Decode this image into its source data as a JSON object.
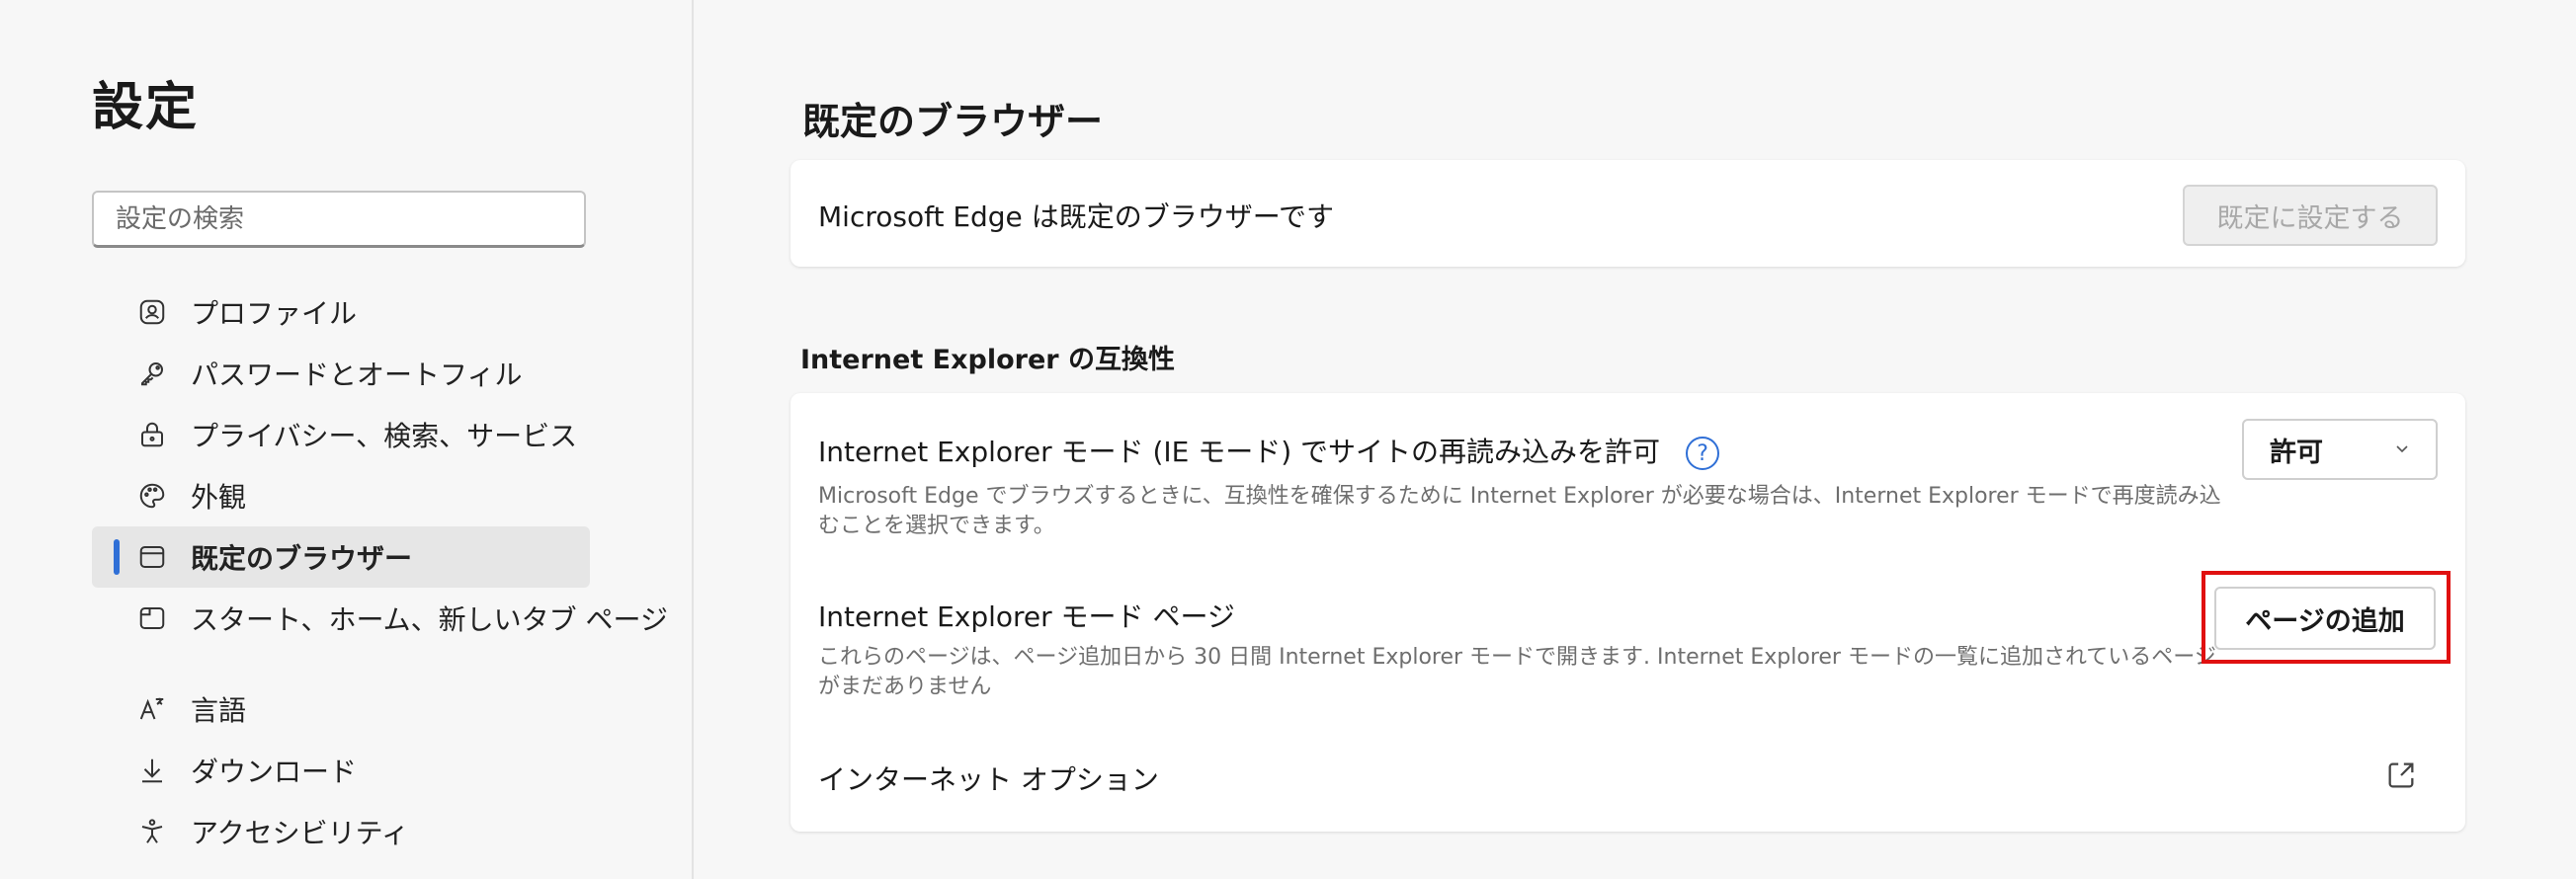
{
  "sidebar": {
    "title": "設定",
    "search_placeholder": "設定の検索",
    "items": [
      {
        "label": "プロファイル",
        "icon": "profile-icon"
      },
      {
        "label": "パスワードとオートフィル",
        "icon": "key-icon"
      },
      {
        "label": "プライバシー、検索、サービス",
        "icon": "lock-icon"
      },
      {
        "label": "外観",
        "icon": "palette-icon"
      },
      {
        "label": "既定のブラウザー",
        "icon": "browser-icon",
        "active": true
      },
      {
        "label": "スタート、ホーム、新しいタブ ページ",
        "icon": "home-tab-icon"
      },
      {
        "label": "言語",
        "icon": "language-icon"
      },
      {
        "label": "ダウンロード",
        "icon": "download-icon"
      },
      {
        "label": "アクセシビリティ",
        "icon": "accessibility-icon"
      }
    ]
  },
  "main": {
    "title": "既定のブラウザー",
    "default_card": {
      "text": "Microsoft Edge は既定のブラウザーです",
      "button_label": "既定に設定する"
    },
    "ie_section": {
      "heading": "Internet Explorer の互換性",
      "reload": {
        "title": "Internet Explorer モード (IE モード) でサイトの再読み込みを許可",
        "help_glyph": "?",
        "description": "Microsoft Edge でブラウズするときに、互換性を確保するために Internet Explorer が必要な場合は、Internet Explorer モードで再度読み込むことを選択できます。",
        "selected_option": "許可"
      },
      "pages": {
        "title": "Internet Explorer モード ページ",
        "description": "これらのページは、ページ追加日から 30 日間 Internet Explorer モードで開きます. Internet Explorer モードの一覧に追加されているページがまだありません",
        "button_label": "ページの追加"
      },
      "internet_options": {
        "label": "インターネット オプション"
      }
    }
  },
  "colors": {
    "accent": "#2f6fd6",
    "highlight": "#e01010"
  }
}
